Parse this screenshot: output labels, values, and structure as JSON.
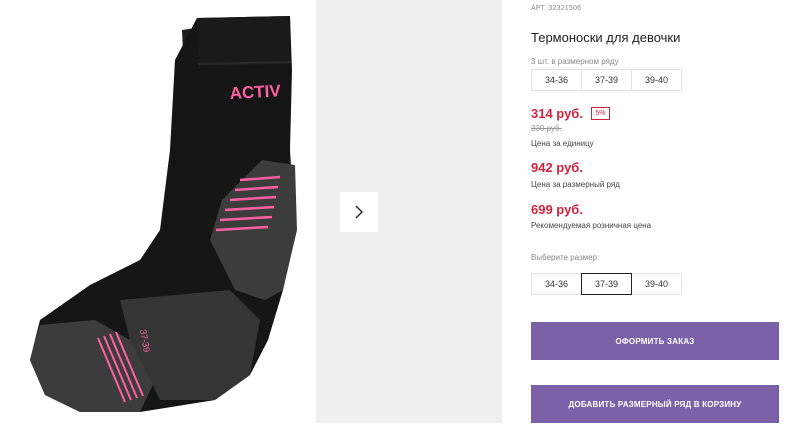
{
  "product": {
    "article": "АРТ. 32321506",
    "title": "Термоноски для девочки",
    "photo_brand_text": "ACTIV",
    "photo_size_text": "37-39"
  },
  "pack": {
    "label": "3 шт. в размерном ряду",
    "sizes": [
      "34-36",
      "37-39",
      "39-40"
    ]
  },
  "prices": {
    "unit_price": "314 руб.",
    "discount_badge": "5%",
    "old_price": "330 руб.",
    "unit_caption": "Цена за единицу",
    "row_price": "942 руб.",
    "row_caption": "Цена за размерный ряд",
    "retail_price": "699 руб.",
    "retail_caption": "Рекомендуемая розничная цена"
  },
  "size_select": {
    "label": "Выберите размер:",
    "options": [
      "34-36",
      "37-39",
      "39-40"
    ],
    "selected": "37-39"
  },
  "buttons": {
    "checkout": "ОФОРМИТЬ ЗАКАЗ",
    "add_row": "ДОБАВИТЬ РАЗМЕРНЫЙ РЯД В КОРЗИНУ"
  },
  "colors": {
    "accent_purple": "#7b62a8",
    "price_red": "#d4213d",
    "sock_black": "#151515",
    "sock_gray": "#3c3c3c",
    "sock_pink": "#ff5fa2"
  }
}
